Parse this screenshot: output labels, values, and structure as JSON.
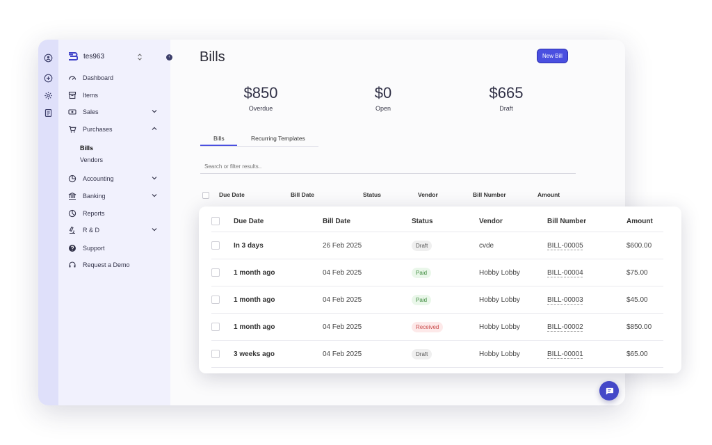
{
  "rail": {
    "icons": [
      "user-circle-icon",
      "plus-circle-icon",
      "gear-icon",
      "document-icon"
    ]
  },
  "sidebar": {
    "org_name": "tes963",
    "collapse_glyph": "‹",
    "items": [
      {
        "label": "Dashboard",
        "icon": "gauge-icon"
      },
      {
        "label": "Items",
        "icon": "archive-icon"
      },
      {
        "label": "Sales",
        "icon": "cash-icon",
        "expandable": true
      },
      {
        "label": "Purchases",
        "icon": "cart-icon",
        "expandable": true,
        "expanded": true
      },
      {
        "label": "Accounting",
        "icon": "pie-icon",
        "expandable": true
      },
      {
        "label": "Banking",
        "icon": "bank-icon",
        "expandable": true
      },
      {
        "label": "Reports",
        "icon": "report-icon"
      },
      {
        "label": "R & D",
        "icon": "microscope-icon",
        "expandable": true
      },
      {
        "label": "Support",
        "icon": "help-icon"
      },
      {
        "label": "Request a Demo",
        "icon": "headset-icon"
      }
    ],
    "purchases_sub": [
      {
        "label": "Bills",
        "active": true
      },
      {
        "label": "Vendors"
      }
    ]
  },
  "page": {
    "title": "Bills",
    "new_button": "New Bill"
  },
  "stats": [
    {
      "value": "$850",
      "label": "Overdue"
    },
    {
      "value": "$0",
      "label": "Open"
    },
    {
      "value": "$665",
      "label": "Draft"
    }
  ],
  "tabs": [
    {
      "label": "Bills",
      "active": true
    },
    {
      "label": "Recurring Templates"
    }
  ],
  "search": {
    "placeholder": "Search or filter results.."
  },
  "table": {
    "columns": [
      "Due Date",
      "Bill Date",
      "Status",
      "Vendor",
      "Bill Number",
      "Amount"
    ],
    "rows": [
      {
        "due": "In 3 days",
        "bill_date": "26 Feb 2025",
        "status": "Draft",
        "vendor": "cvde",
        "number": "BILL-00005",
        "amount": "$600.00"
      },
      {
        "due": "1 month ago",
        "bill_date": "04 Feb 2025",
        "status": "Paid",
        "vendor": "Hobby Lobby",
        "number": "BILL-00004",
        "amount": "$75.00"
      },
      {
        "due": "1 month ago",
        "bill_date": "04 Feb 2025",
        "status": "Paid",
        "vendor": "Hobby Lobby",
        "number": "BILL-00003",
        "amount": "$45.00"
      },
      {
        "due": "1 month ago",
        "bill_date": "04 Feb 2025",
        "status": "Received",
        "vendor": "Hobby Lobby",
        "number": "BILL-00002",
        "amount": "$850.00"
      },
      {
        "due": "3 weeks ago",
        "bill_date": "04 Feb 2025",
        "status": "Draft",
        "vendor": "Hobby Lobby",
        "number": "BILL-00001",
        "amount": "$65.00"
      }
    ]
  },
  "chat": {
    "icon": "chat-icon"
  },
  "colors": {
    "accent": "#4a4fe0",
    "rail": "#dfe0fa",
    "sidebar": "#f1f1fd"
  }
}
